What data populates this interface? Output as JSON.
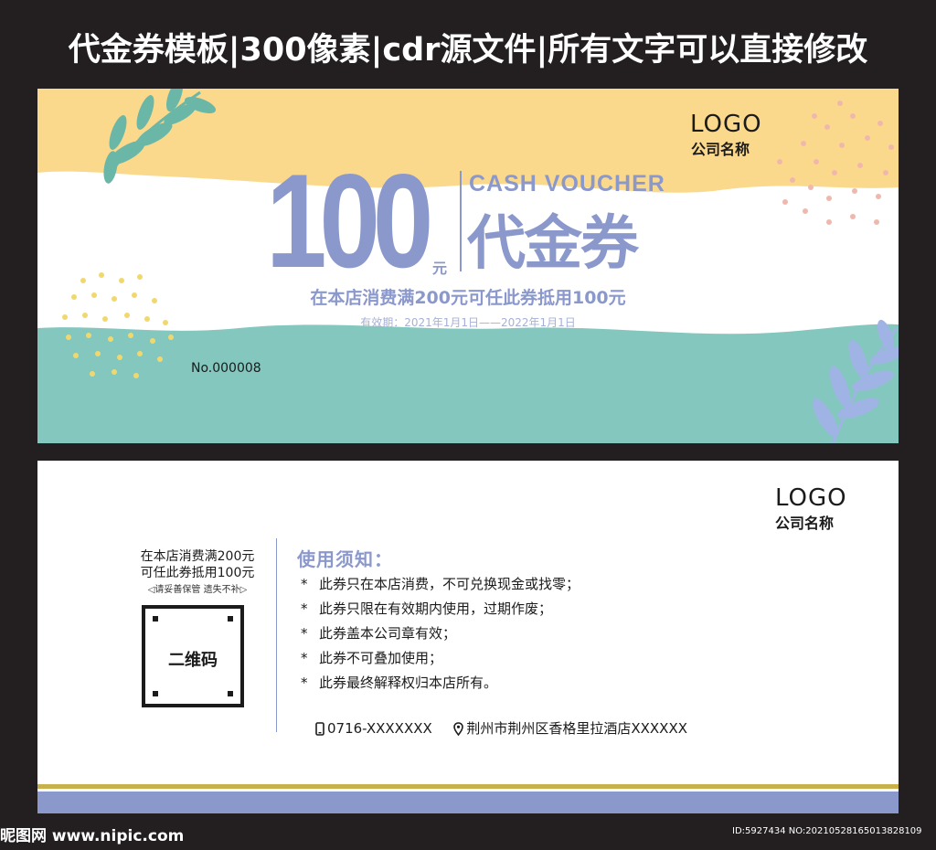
{
  "banner": {
    "title": "代金券模板|300像素|cdr源文件|所有文字可以直接修改"
  },
  "front": {
    "logo": "LOGO",
    "company": "公司名称",
    "amount": "100",
    "amount_unit": "元",
    "cash_voucher": "CASH VOUCHER",
    "voucher_name": "代金券",
    "usage_rule": "在本店消费满200元可任此券抵用100元",
    "validity": "有效期：2021年1月1日——2022年1月1日",
    "serial_no": "No.000008",
    "colors": {
      "yellow": "#fbd98c",
      "teal": "#84c7be",
      "periwinkle": "#8b98cc",
      "pink": "#f0b8ad",
      "leaf": "#6ab7a8",
      "leaf_blue": "#9fb4e4"
    },
    "icons": [
      "leaf-icon",
      "dots-pattern-icon"
    ]
  },
  "back": {
    "logo": "LOGO",
    "company": "公司名称",
    "rule_line1": "在本店消费满200元",
    "rule_line2": "可任此券抵用100元",
    "keep_note": "◁请妥善保管  遗失不补▷",
    "qr_label": "二维码",
    "notice_title": "使用须知：",
    "notices": [
      "此券只在本店消费，不可兑换现金或找零；",
      "此券只限在有效期内使用，过期作废；",
      "此券盖本公司章有效；",
      "此券不可叠加使用；",
      "此券最终解释权归本店所有。"
    ],
    "notice_bullet": "*",
    "phone": "0716-XXXXXXX",
    "address": "荆州市荆州区香格里拉酒店XXXXXX",
    "icons": [
      "phone-icon",
      "location-pin-icon"
    ]
  },
  "footer": {
    "watermark": "昵图网 www.nipic.com",
    "id_info": "ID:5927434 NO:20210528165013828109"
  }
}
